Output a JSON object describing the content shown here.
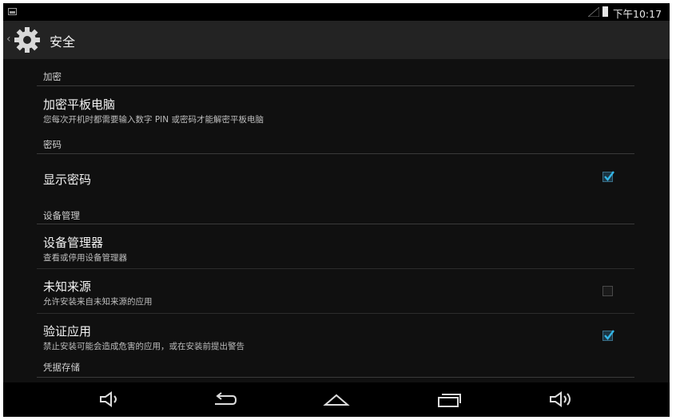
{
  "status_bar": {
    "time": "下午10:17"
  },
  "action_bar": {
    "title": "安全",
    "icon": "gear-icon"
  },
  "sections": {
    "encryption": {
      "header": "加密",
      "encrypt_tablet": {
        "title": "加密平板电脑",
        "summary": "您每次开机时都需要输入数字 PIN 或密码才能解密平板电脑"
      }
    },
    "passwords": {
      "header": "密码",
      "show_password": {
        "title": "显示密码",
        "checked": true
      }
    },
    "device_admin": {
      "header": "设备管理",
      "device_administrators": {
        "title": "设备管理器",
        "summary": "查看或停用设备管理器"
      },
      "unknown_sources": {
        "title": "未知来源",
        "summary": "允许安装来自未知来源的应用",
        "checked": false
      },
      "verify_apps": {
        "title": "验证应用",
        "summary": "禁止安装可能会造成危害的应用，或在安装前提出警告",
        "checked": true
      }
    },
    "credential_storage": {
      "header": "凭据存储"
    }
  },
  "nav_bar": {
    "buttons": [
      "volume-down-icon",
      "back-icon",
      "home-icon",
      "recents-icon",
      "volume-up-icon"
    ]
  },
  "colors": {
    "background": "#101010",
    "action_bar": "#232323",
    "accent_check": "#33b5e5"
  }
}
